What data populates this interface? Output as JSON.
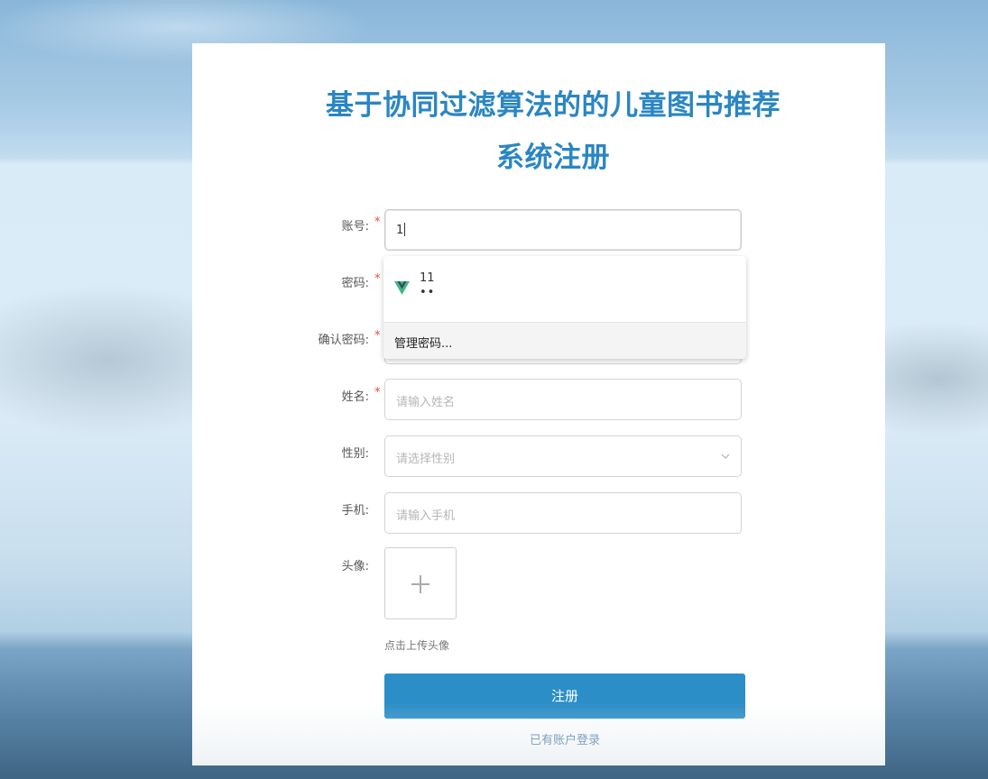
{
  "page": {
    "title_line1": "基于协同过滤算法的的儿童图书推荐",
    "title_line2": "系统注册"
  },
  "form": {
    "account": {
      "label": "账号:",
      "required": "*",
      "value": "1"
    },
    "password": {
      "label": "密码:",
      "required": "*"
    },
    "confirm_password": {
      "label": "确认密码:",
      "required": "*"
    },
    "name": {
      "label": "姓名:",
      "required": "*",
      "placeholder": "请输入姓名"
    },
    "gender": {
      "label": "性别:",
      "placeholder": "请选择性别"
    },
    "phone": {
      "label": "手机:",
      "placeholder": "请输入手机"
    },
    "avatar": {
      "label": "头像:",
      "hint": "点击上传头像"
    },
    "submit_label": "注册",
    "login_link": "已有账户登录"
  },
  "autofill": {
    "username": "11",
    "password_mask": "••",
    "manage_label": "管理密码..."
  },
  "colors": {
    "title": "#2a86c2",
    "button": "#2c8ec7",
    "required": "#e74c3c",
    "link": "#4d7fa8"
  },
  "icons": {
    "autofill": "vue-logo-icon",
    "select": "chevron-down-icon",
    "upload": "plus-icon",
    "cursor": "text-cursor-icon"
  }
}
